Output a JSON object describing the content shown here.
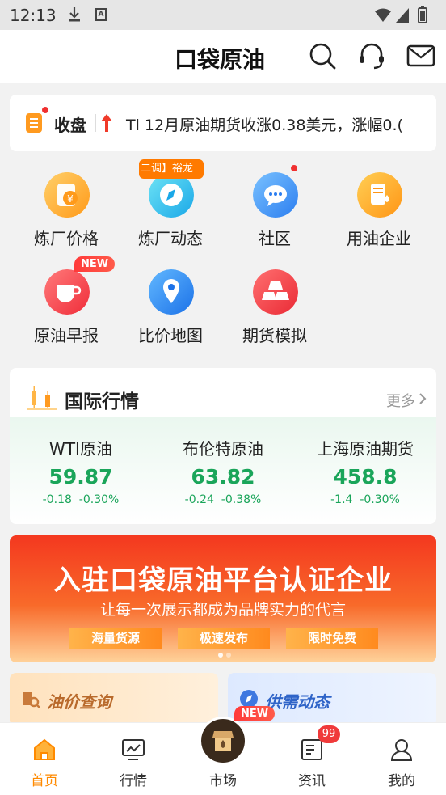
{
  "status_bar": {
    "time": "12:13"
  },
  "header": {
    "logo_text": "口袋原油"
  },
  "ticker": {
    "label": "收盘",
    "text": "Tl 12月原油期货收涨0.38美元，涨幅0.("
  },
  "grid": {
    "items": [
      {
        "label": "炼厂价格",
        "icon": "refinery-price-icon"
      },
      {
        "label": "炼厂动态",
        "icon": "compass-icon",
        "tag": "二调】裕龙"
      },
      {
        "label": "社区",
        "icon": "chat-bubble-icon"
      },
      {
        "label": "用油企业",
        "icon": "oil-company-icon"
      },
      {
        "label": "原油早报",
        "icon": "coffee-cup-icon",
        "badge": "NEW"
      },
      {
        "label": "比价地图",
        "icon": "map-pin-icon"
      },
      {
        "label": "期货模拟",
        "icon": "gold-bars-icon"
      }
    ]
  },
  "market": {
    "title": "国际行情",
    "more": "更多",
    "quotes": [
      {
        "name": "WTI原油",
        "price": "59.87",
        "change": "-0.18",
        "percent": "-0.30%"
      },
      {
        "name": "布伦特原油",
        "price": "63.82",
        "change": "-0.24",
        "percent": "-0.38%"
      },
      {
        "name": "上海原油期货",
        "price": "458.8",
        "change": "-1.4",
        "percent": "-0.30%"
      }
    ],
    "color_down": "#1aa55a"
  },
  "banner": {
    "title": "入驻口袋原油平台认证企业",
    "subtitle": "让每一次展示都成为品牌实力的代言",
    "pills": [
      "海量货源",
      "极速发布",
      "限时免费"
    ]
  },
  "cards": [
    {
      "title": "油价查询"
    },
    {
      "title": "供需动态"
    }
  ],
  "tabbar": {
    "items": [
      {
        "label": "首页",
        "active": true
      },
      {
        "label": "行情"
      },
      {
        "label": "市场",
        "badge": "NEW"
      },
      {
        "label": "资讯",
        "count": "99"
      },
      {
        "label": "我的"
      }
    ],
    "accent": "#ff8a00"
  }
}
